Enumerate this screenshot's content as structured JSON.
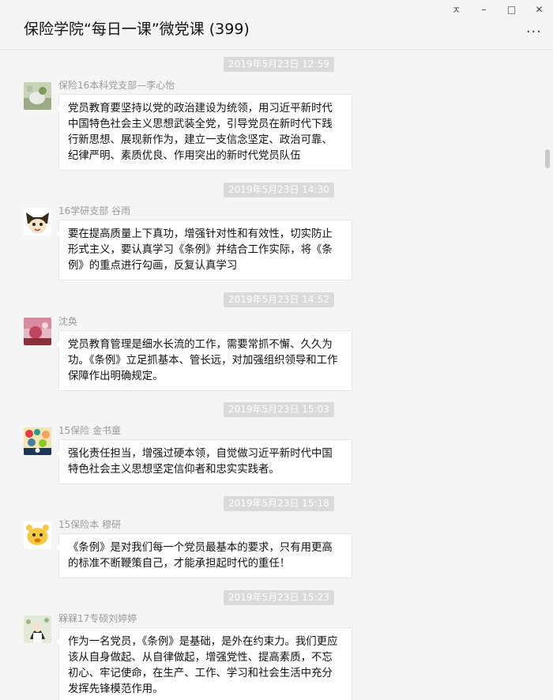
{
  "window": {
    "title": "保险学院“每日一课”微党课 (399)",
    "controls": {
      "pin": "ㅈ",
      "minimize": "–",
      "maximize": "□",
      "close": "✕"
    },
    "more": "···"
  },
  "messages": [
    {
      "timestamp": "2019年5月23日 12:59",
      "sender": "保险16本科党支部—李心怡",
      "avatar_icon": "photo-avatar",
      "text": "党员教育要坚持以党的政治建设为统领，用习近平新时代中国特色社会主义思想武装全党，引导党员在新时代下践行新思想、展现新作为，建立一支信念坚定、政治可靠、纪律严明、素质优良、作用突出的新时代党员队伍"
    },
    {
      "timestamp": "2019年5月23日 14:30",
      "sender": "16学研支部 谷雨",
      "avatar_icon": "cartoon-avatar",
      "text": "要在提高质量上下真功，增强针对性和有效性，切实防止形式主义，要认真学习《条例》并结合工作实际，将《条例》的重点进行勾画，反复认真学习"
    },
    {
      "timestamp": "2019年5月23日 14:52",
      "sender": "沈奂",
      "avatar_icon": "photo-avatar",
      "text": "党员教育管理是细水长流的工作，需要常抓不懈、久久为功。《条例》立足抓基本、管长远，对加强组织领导和工作保障作出明确规定。"
    },
    {
      "timestamp": "2019年5月23日 15:03",
      "sender": "15保险 金书童",
      "avatar_icon": "colorful-avatar",
      "text": "强化责任担当，增强过硬本领，自觉做习近平新时代中国特色社会主义思想坚定信仰者和忠实实践者。"
    },
    {
      "timestamp": "2019年5月23日 15:18",
      "sender": "15保险本 穆研",
      "avatar_icon": "cartoon-avatar",
      "text": "《条例》是对我们每一个党员最基本的要求，只有用更高的标准不断鞭策自己，才能承担起时代的重任！"
    },
    {
      "timestamp": "2019年5月23日 15:23",
      "sender": "槑槑17专硕刘婷婷",
      "avatar_icon": "drawing-avatar",
      "text": "作为一名党员，《条例》是基础，是外在约束力。我们更应该从自身做起、从自律做起，增强党性、提高素质，不忘初心、牢记使命，在生产、工作、学习和社会生活中充分发挥先锋模范作用。"
    }
  ]
}
